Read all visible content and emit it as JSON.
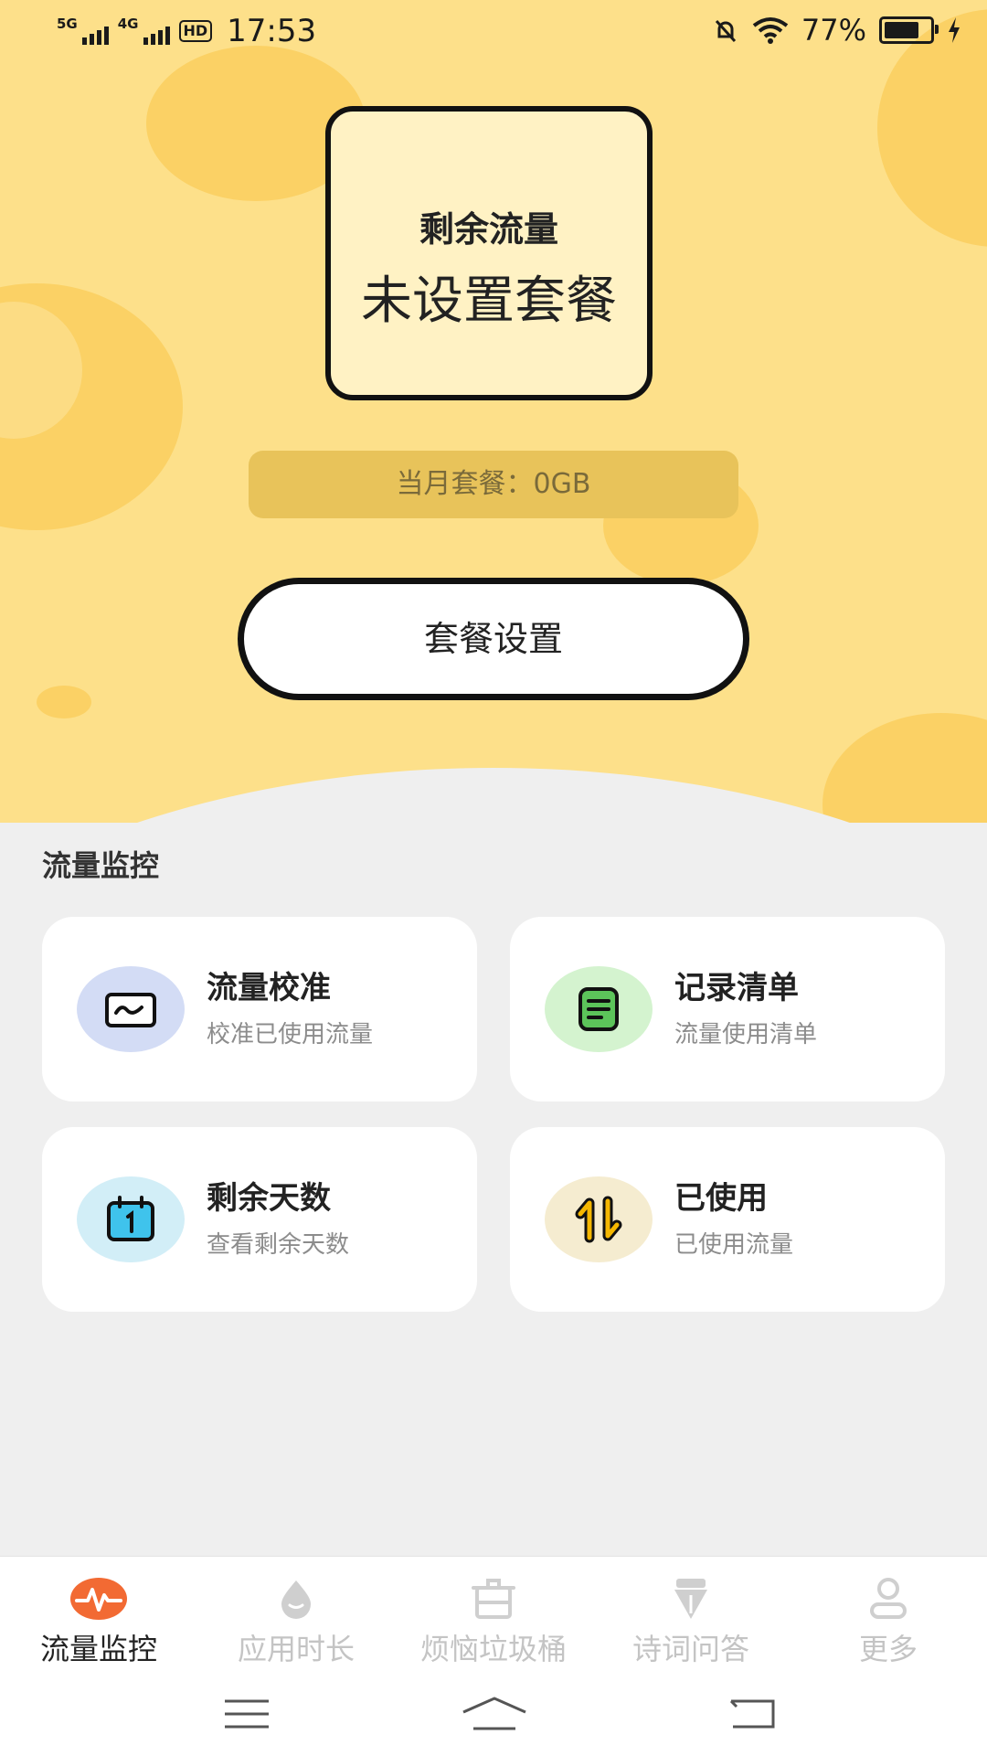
{
  "status_bar": {
    "network1": "5G",
    "network2": "4G",
    "hd": "HD",
    "time": "17:53",
    "battery": "77%",
    "battery_level": 0.77
  },
  "hero": {
    "remain_title": "剩余流量",
    "remain_value": "未设置套餐",
    "monthly_plan": "当月套餐：0GB",
    "plan_settings_button": "套餐设置"
  },
  "section": {
    "title": "流量监控",
    "cards": [
      {
        "title": "流量校准",
        "subtitle": "校准已使用流量",
        "icon": "chart-monitor-icon",
        "icon_bg": "#d3dcf5"
      },
      {
        "title": "记录清单",
        "subtitle": "流量使用清单",
        "icon": "list-document-icon",
        "icon_bg": "#d4f3cf"
      },
      {
        "title": "剩余天数",
        "subtitle": "查看剩余天数",
        "icon": "calendar-icon",
        "icon_bg": "#d2eef7"
      },
      {
        "title": "已使用",
        "subtitle": "已使用流量",
        "icon": "up-down-arrows-icon",
        "icon_bg": "#f5ecd0"
      }
    ]
  },
  "bottom_nav": {
    "tabs": [
      {
        "label": "流量监控",
        "icon": "pulse-icon",
        "active": true
      },
      {
        "label": "应用时长",
        "icon": "drop-icon",
        "active": false
      },
      {
        "label": "烦恼垃圾桶",
        "icon": "trash-bin-icon",
        "active": false
      },
      {
        "label": "诗词问答",
        "icon": "pen-nib-icon",
        "active": false
      },
      {
        "label": "更多",
        "icon": "person-icon",
        "active": false
      }
    ]
  },
  "colors": {
    "hero_bg": "#fde08a",
    "active_icon": "#f26a33",
    "inactive": "#c4c4c4"
  }
}
